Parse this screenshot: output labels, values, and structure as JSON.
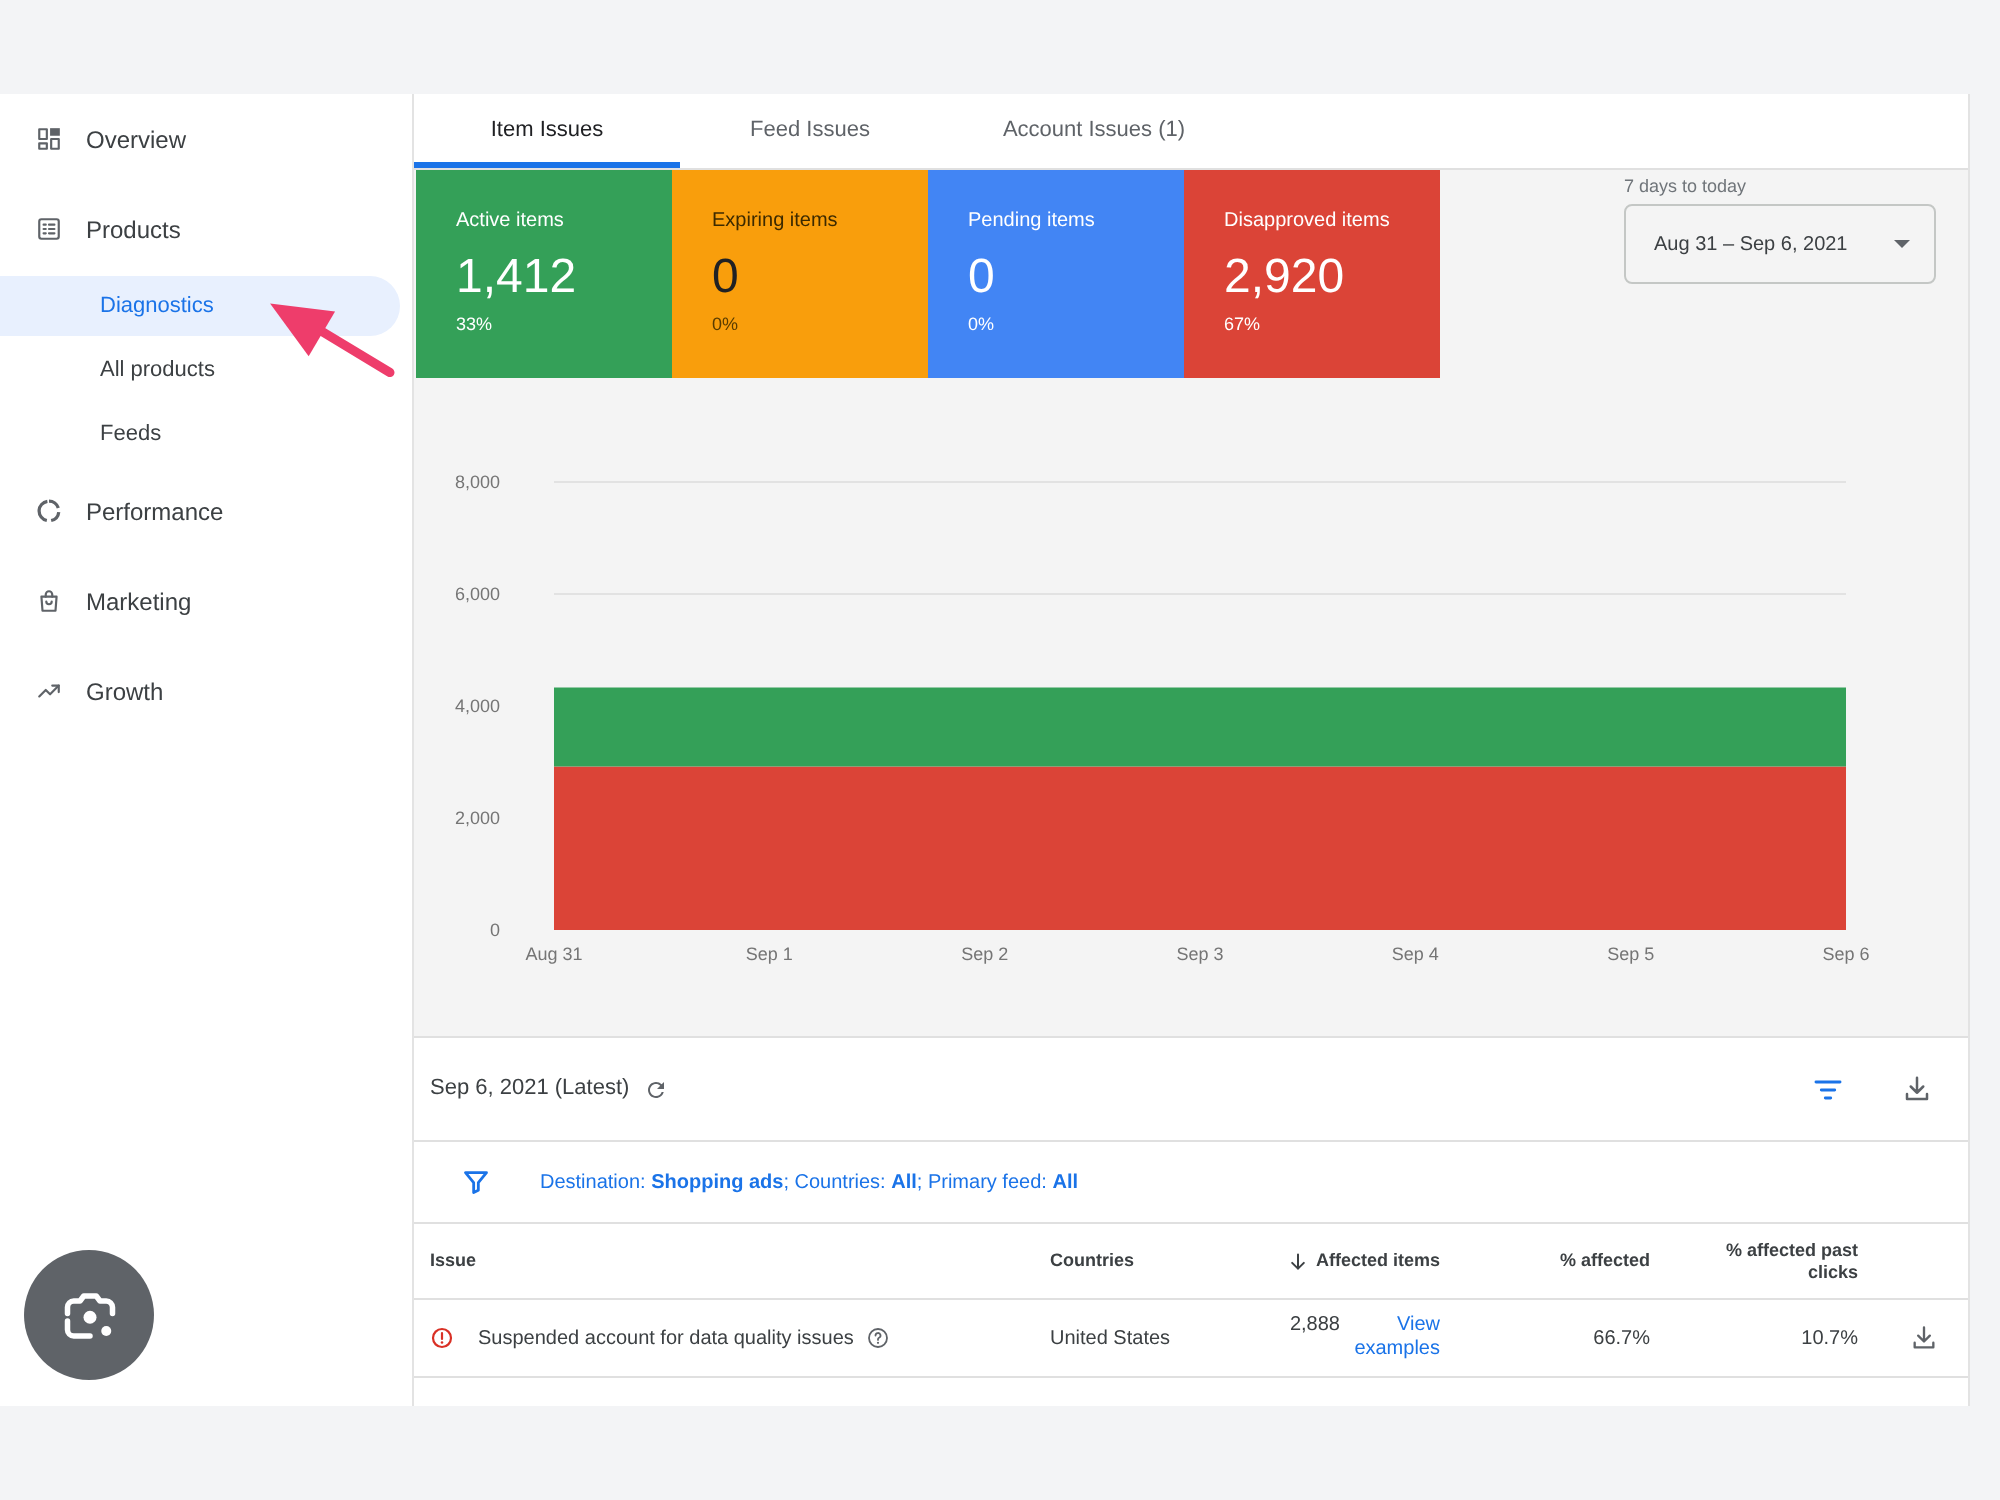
{
  "sidebar": {
    "items": [
      {
        "label": "Overview",
        "selected": false
      },
      {
        "label": "Products",
        "selected": false,
        "children": [
          {
            "label": "Diagnostics",
            "selected": true
          },
          {
            "label": "All products",
            "selected": false
          },
          {
            "label": "Feeds",
            "selected": false
          }
        ]
      },
      {
        "label": "Performance",
        "selected": false
      },
      {
        "label": "Marketing",
        "selected": false
      },
      {
        "label": "Growth",
        "selected": false
      }
    ]
  },
  "tabs": [
    {
      "label": "Item Issues",
      "selected": true
    },
    {
      "label": "Feed Issues",
      "selected": false
    },
    {
      "label": "Account Issues (1)",
      "selected": false
    }
  ],
  "summary_cards": [
    {
      "label": "Active items",
      "value": "1,412",
      "percent": "33%",
      "color": "#34a058"
    },
    {
      "label": "Expiring items",
      "value": "0",
      "percent": "0%",
      "color": "#f99e0c"
    },
    {
      "label": "Pending items",
      "value": "0",
      "percent": "0%",
      "color": "#4285f4"
    },
    {
      "label": "Disapproved items",
      "value": "2,920",
      "percent": "67%",
      "color": "#db4437"
    }
  ],
  "date_range": {
    "label": "7 days to today",
    "value": "Aug 31 – Sep 6, 2021"
  },
  "chart": {
    "chart_data": {
      "type": "area",
      "categories": [
        "Aug 31",
        "Sep 1",
        "Sep 2",
        "Sep 3",
        "Sep 4",
        "Sep 5",
        "Sep 6"
      ],
      "series": [
        {
          "color": "#db4437",
          "values": [
            2920,
            2920,
            2920,
            2920,
            2920,
            2920,
            2920
          ]
        },
        {
          "color": "#34a058",
          "values": [
            1410,
            1410,
            1410,
            1410,
            1410,
            1410,
            1410
          ]
        }
      ],
      "stacked": true,
      "ylim": [
        0,
        8000
      ],
      "yticks": [
        0,
        {
          "value": 2000,
          "label": "2,000"
        },
        {
          "value": 4000,
          "label": "4,000"
        },
        {
          "value": 6000,
          "label": "6,000"
        },
        {
          "value": 8000,
          "label": "8,000"
        }
      ]
    }
  },
  "issues": {
    "date": "Sep 6, 2021 (Latest)",
    "filter": "Destination: **Shopping ads**; Countries: **All**; Primary feed: **All**",
    "table": {
      "columns": [
        {
          "label": "Issue",
          "sorted": false
        },
        {
          "label": "Countries",
          "sorted": false
        },
        {
          "label": "Affected items",
          "sorted": true
        },
        {
          "label": "% affected",
          "sorted": false
        },
        {
          "label": "% affected past clicks",
          "sorted": false
        }
      ],
      "rows": [
        {
          "issue": "Suspended account for data quality issues",
          "countries": "United States",
          "affected_items": "2,888",
          "link": "View examples",
          "percent_affected": "66.7%",
          "percent_affected_past_clicks": "10.7%"
        }
      ]
    }
  }
}
